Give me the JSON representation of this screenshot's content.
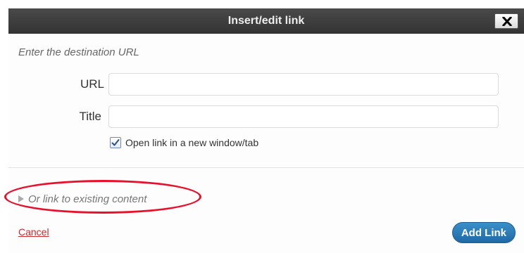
{
  "dialog": {
    "title": "Insert/edit link",
    "close_label": "×"
  },
  "form": {
    "hint": "Enter the destination URL",
    "url_label": "URL",
    "url_value": "",
    "title_label": "Title",
    "title_value": "",
    "new_window_label": "Open link in a new window/tab",
    "new_window_checked": true
  },
  "existing": {
    "toggle_label": "Or link to existing content",
    "highlight_color": "#e8102a"
  },
  "actions": {
    "cancel_label": "Cancel",
    "add_label": "Add Link"
  },
  "icons": {
    "close": "close-icon",
    "check": "checkmark-icon",
    "toggle": "triangle-right-icon"
  },
  "colors": {
    "titlebar": "#3c3c3c",
    "primary_button": "#2a7cb8",
    "cancel_link": "#cc2b2b"
  }
}
